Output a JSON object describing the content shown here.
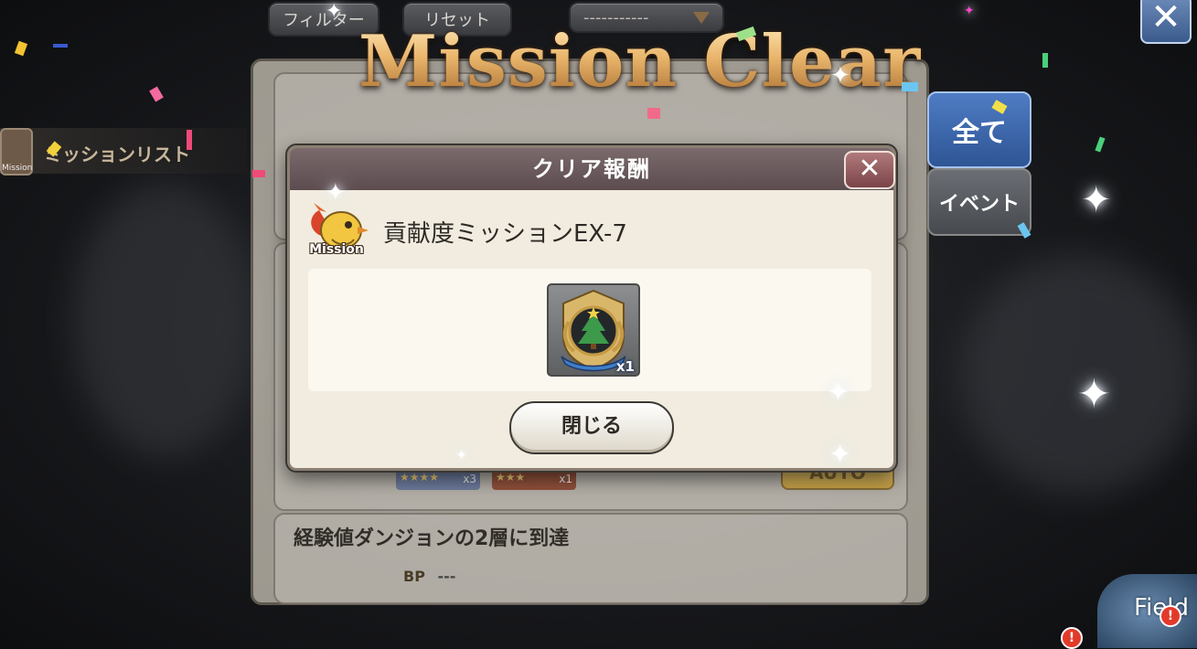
{
  "top_bar": {
    "filter_label": "フィルター",
    "reset_label": "リセット",
    "dropdown_value": "-----------",
    "close_glyph": "✕"
  },
  "left_tab": {
    "icon_text": "Mission",
    "label": "ミッションリスト"
  },
  "side_tabs": {
    "all_label": "全て",
    "event_label": "イベント"
  },
  "banner": {
    "text": "Mission Clear"
  },
  "dialog": {
    "title": "クリア報酬",
    "close_glyph": "✕",
    "mission_icon_label": "Mission",
    "mission_name": "貢献度ミッションEX-7",
    "reward": {
      "icon": "christmas-tree-emblem-icon",
      "quantity": "x1"
    },
    "close_button_label": "閉じる"
  },
  "background_cards": {
    "auto_label": "AUTO",
    "item_qty_1": "x3",
    "item_qty_2": "x1",
    "second_mission_title": "経験値ダンジョンの2層に到達",
    "bp_label": "BP",
    "bp_value": "---"
  },
  "corner": {
    "field_label": "Field",
    "badge": "!"
  },
  "colors": {
    "banner_gold": "#e9b56b",
    "dialog_header": "#6c5b5e",
    "tab_all": "#3b5f9a"
  }
}
